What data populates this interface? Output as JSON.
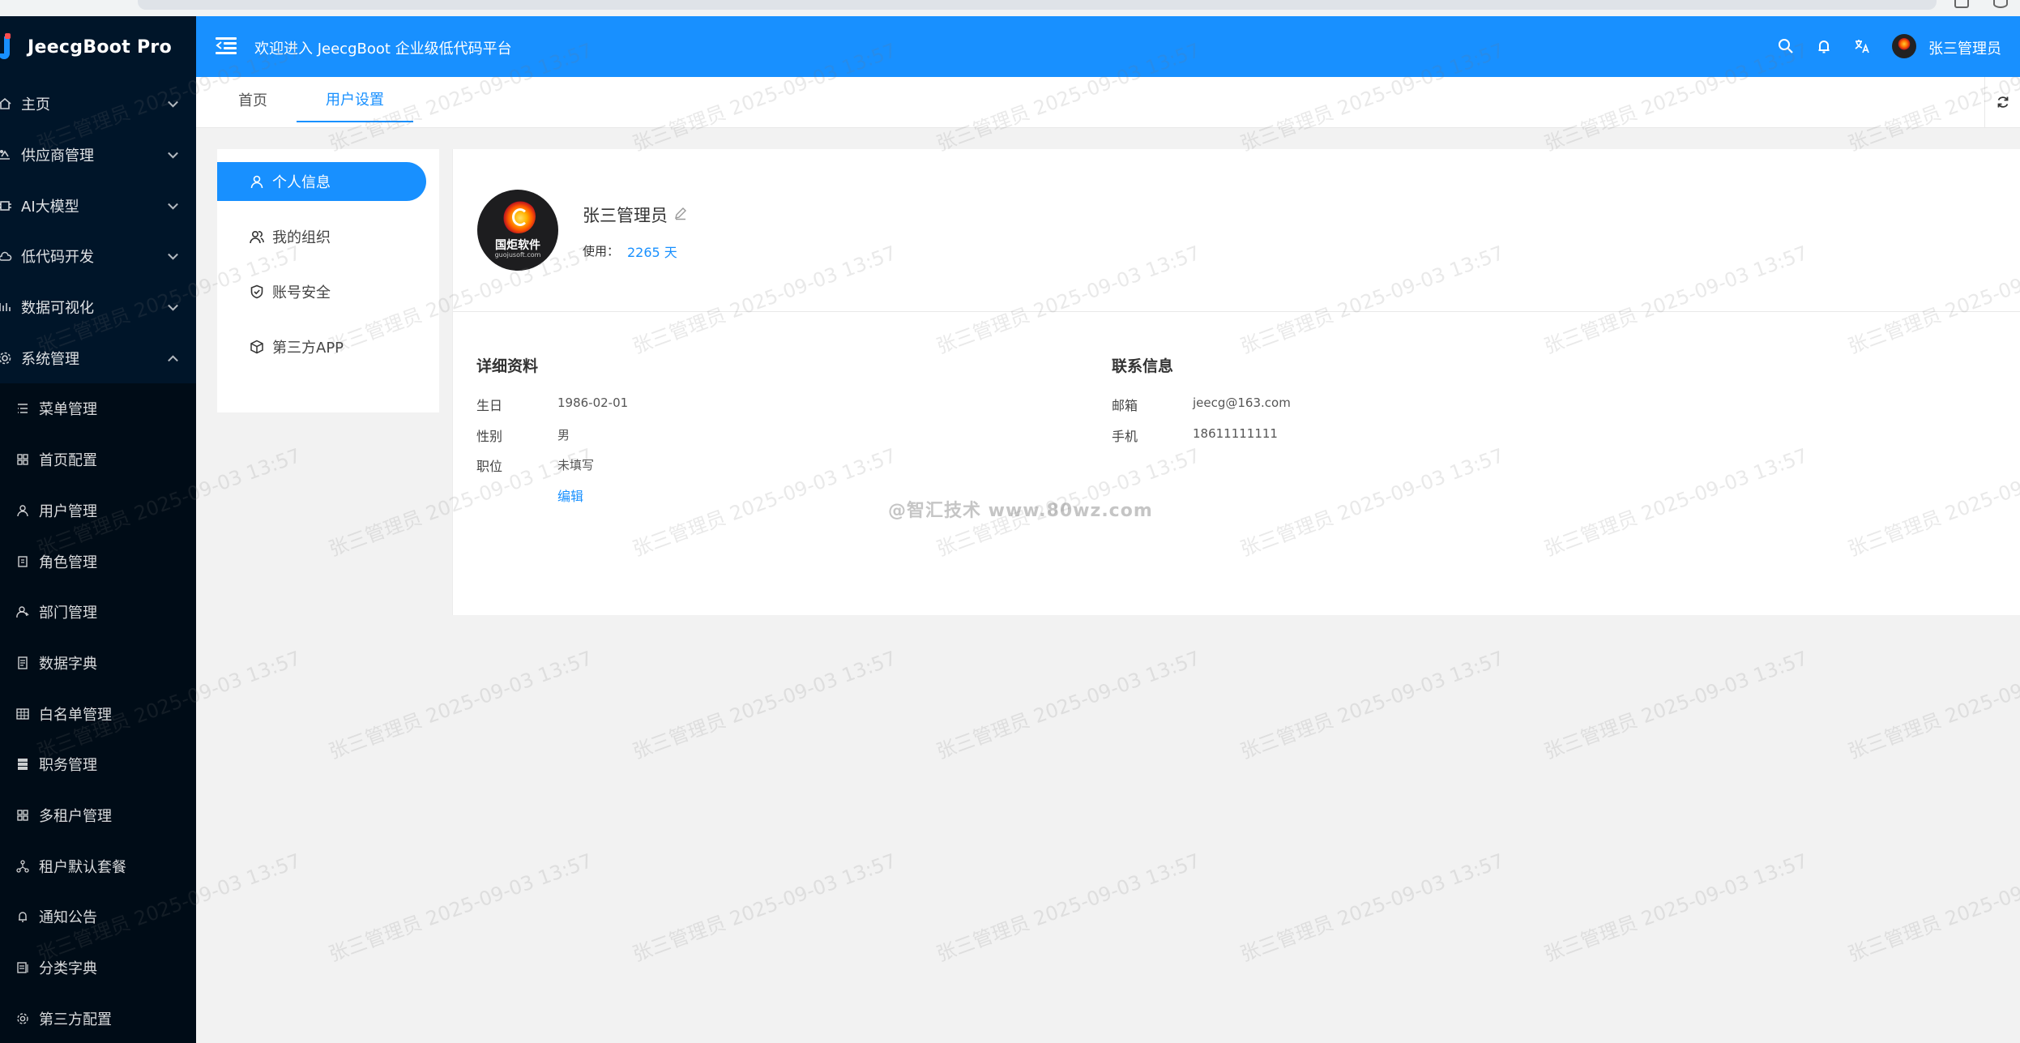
{
  "app": {
    "name": "JeecgBoot Pro"
  },
  "sidebar": {
    "items": [
      {
        "label": "主页",
        "icon": "home-icon",
        "expandable": true
      },
      {
        "label": "供应商管理",
        "icon": "supplier-icon",
        "expandable": true
      },
      {
        "label": "AI大模型",
        "icon": "ai-icon",
        "expandable": true
      },
      {
        "label": "低代码开发",
        "icon": "cloud-icon",
        "expandable": true
      },
      {
        "label": "数据可视化",
        "icon": "chart-icon",
        "expandable": true
      },
      {
        "label": "系统管理",
        "icon": "gear-icon",
        "expandable": true,
        "expanded": true
      }
    ],
    "sub_items": [
      {
        "label": "菜单管理",
        "icon": "list-icon"
      },
      {
        "label": "首页配置",
        "icon": "grid-icon"
      },
      {
        "label": "用户管理",
        "icon": "user-icon"
      },
      {
        "label": "角色管理",
        "icon": "role-icon"
      },
      {
        "label": "部门管理",
        "icon": "department-icon"
      },
      {
        "label": "数据字典",
        "icon": "dictionary-icon"
      },
      {
        "label": "白名单管理",
        "icon": "table-icon"
      },
      {
        "label": "职务管理",
        "icon": "position-icon"
      },
      {
        "label": "多租户管理",
        "icon": "tenant-icon"
      },
      {
        "label": "租户默认套餐",
        "icon": "cluster-icon"
      },
      {
        "label": "通知公告",
        "icon": "bell-icon"
      },
      {
        "label": "分类字典",
        "icon": "category-icon"
      },
      {
        "label": "第三方配置",
        "icon": "gear-icon"
      }
    ]
  },
  "header": {
    "welcome": "欢迎进入 JeecgBoot 企业级低代码平台",
    "user_name": "张三管理员",
    "accent_color": "#1890ff"
  },
  "tabs": [
    {
      "label": "首页",
      "active": false
    },
    {
      "label": "用户设置",
      "active": true
    }
  ],
  "settings_menu": [
    {
      "label": "个人信息",
      "icon": "user-icon",
      "active": true
    },
    {
      "label": "我的组织",
      "icon": "team-icon",
      "active": false
    },
    {
      "label": "账号安全",
      "icon": "shield-icon",
      "active": false
    },
    {
      "label": "第三方APP",
      "icon": "box-icon",
      "active": false
    }
  ],
  "profile": {
    "name": "张三管理员",
    "avatar_brand": "国炬软件",
    "avatar_brand_sub": "guojusoft.com",
    "usage_label": "使用：",
    "usage_value": "2265 天"
  },
  "details": {
    "title": "详细资料",
    "rows": [
      {
        "label": "生日",
        "value": "1986-02-01"
      },
      {
        "label": "性别",
        "value": "男"
      },
      {
        "label": "职位",
        "value": "未填写"
      }
    ],
    "edit_label": "编辑"
  },
  "contact": {
    "title": "联系信息",
    "rows": [
      {
        "label": "邮箱",
        "value": "jeecg@163.com"
      },
      {
        "label": "手机",
        "value": "18611111111"
      }
    ]
  },
  "watermark": {
    "text": "张三管理员 2025-09-03 13:57"
  },
  "site_watermark": "@智汇技术 www.80wz.com"
}
